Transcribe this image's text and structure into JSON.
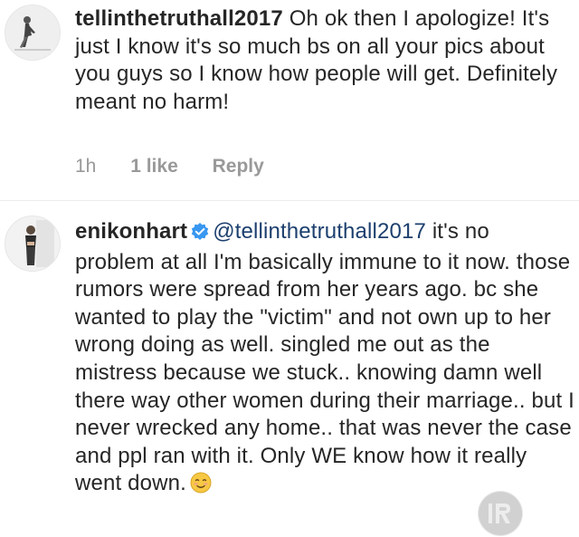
{
  "comments": [
    {
      "username": "tellinthetruthall2017",
      "verified": false,
      "mention": "",
      "text": " Oh ok then I apologize! It's just I know it's so much bs on all your pics about you guys so I know how people will get. Definitely meant no harm!",
      "time": "1h",
      "likes": "1 like",
      "reply_label": "Reply"
    },
    {
      "username": "enikonhart",
      "verified": true,
      "mention": "@tellinthetruthall2017",
      "text": " it's no problem at all I'm basically immune to it now. those rumors were spread from her years ago. bc she wanted to play the \"victim\" and not own up to her wrong doing as well. singled me out as the mistress because we stuck.. knowing damn well there way other women during their marriage.. but I never wrecked any home.. that was never the case and ppl ran with it. Only WE know how it really went down.",
      "emoji": "smiling-face-icon"
    }
  ],
  "colors": {
    "text": "#262626",
    "meta": "#999999",
    "verified_badge": "#3897f0",
    "divider": "#ececec"
  }
}
